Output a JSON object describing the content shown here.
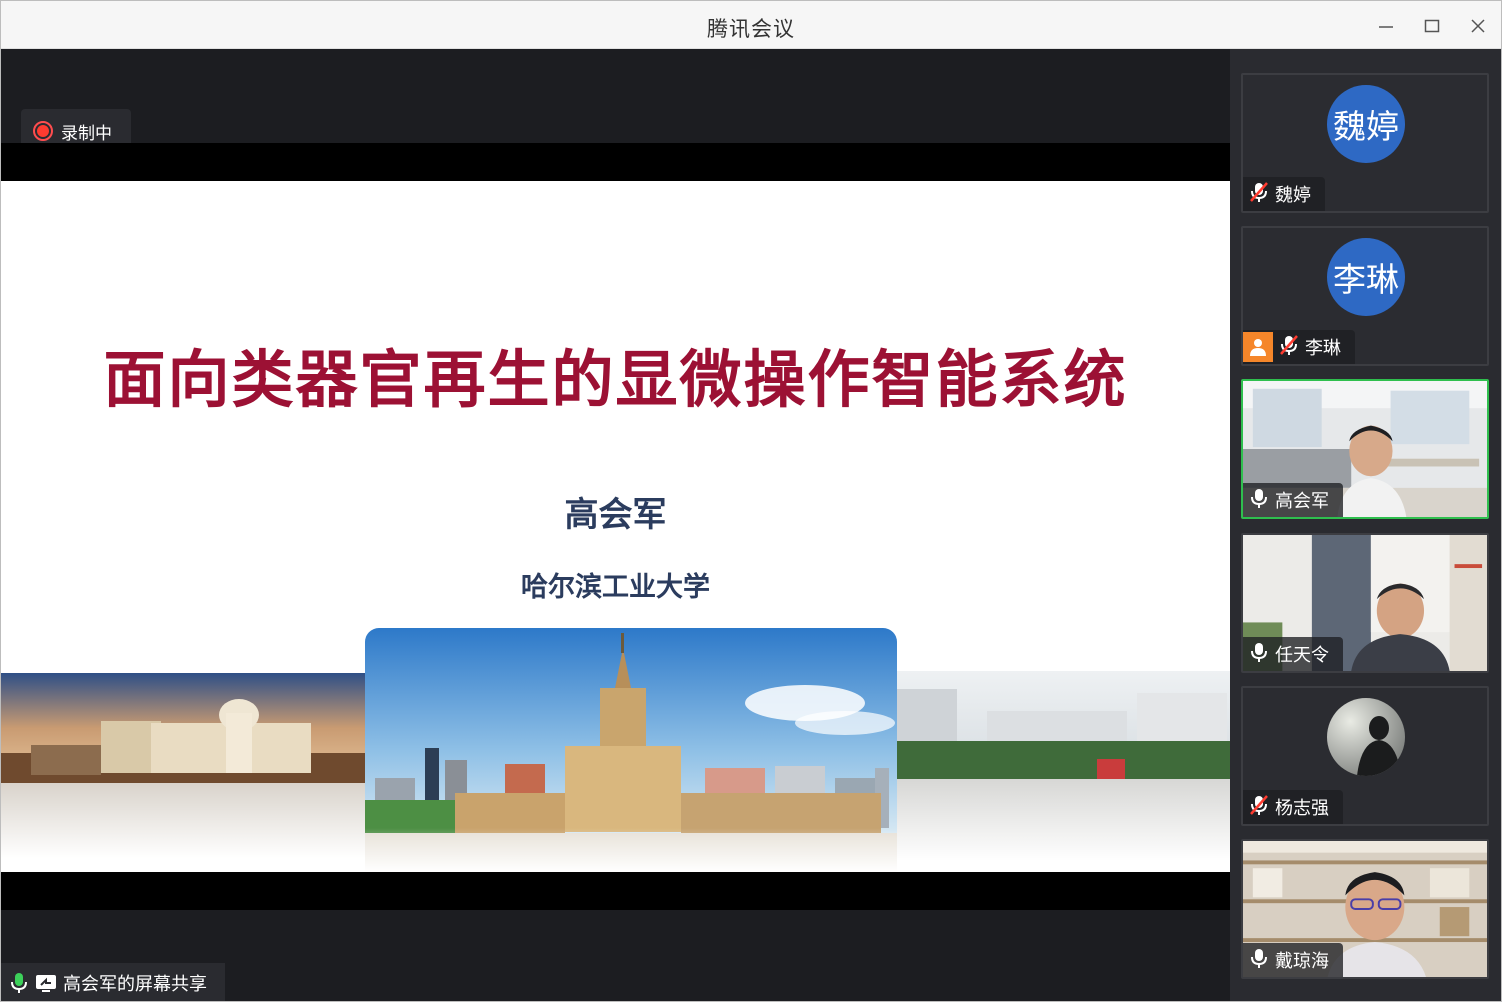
{
  "window": {
    "title": "腾讯会议"
  },
  "recording": {
    "label": "录制中",
    "color": "#ff3b30"
  },
  "slide": {
    "title": "面向类器官再生的显微操作智能系统",
    "author": "高会军",
    "organization": "哈尔滨工业大学",
    "colors": {
      "title": "#9c1134",
      "text": "#2b3c5e"
    }
  },
  "screen_share": {
    "label": "高会军的屏幕共享"
  },
  "participants": [
    {
      "name": "魏婷",
      "avatar_text": "魏婷",
      "muted": true,
      "video": false,
      "host": false,
      "speaking": false
    },
    {
      "name": "李琳",
      "avatar_text": "李琳",
      "muted": true,
      "video": false,
      "host": true,
      "speaking": false
    },
    {
      "name": "高会军",
      "muted": false,
      "video": true,
      "host": false,
      "speaking": true
    },
    {
      "name": "任天令",
      "muted": false,
      "video": true,
      "host": false,
      "speaking": false
    },
    {
      "name": "杨志强",
      "muted": true,
      "video": false,
      "host": false,
      "speaking": false
    },
    {
      "name": "戴琼海",
      "muted": false,
      "video": true,
      "host": false,
      "speaking": false
    }
  ],
  "colors": {
    "speaking_border": "#2fbf4e",
    "avatar_bg": "#2e69c4",
    "host_badge": "#f5862a"
  }
}
